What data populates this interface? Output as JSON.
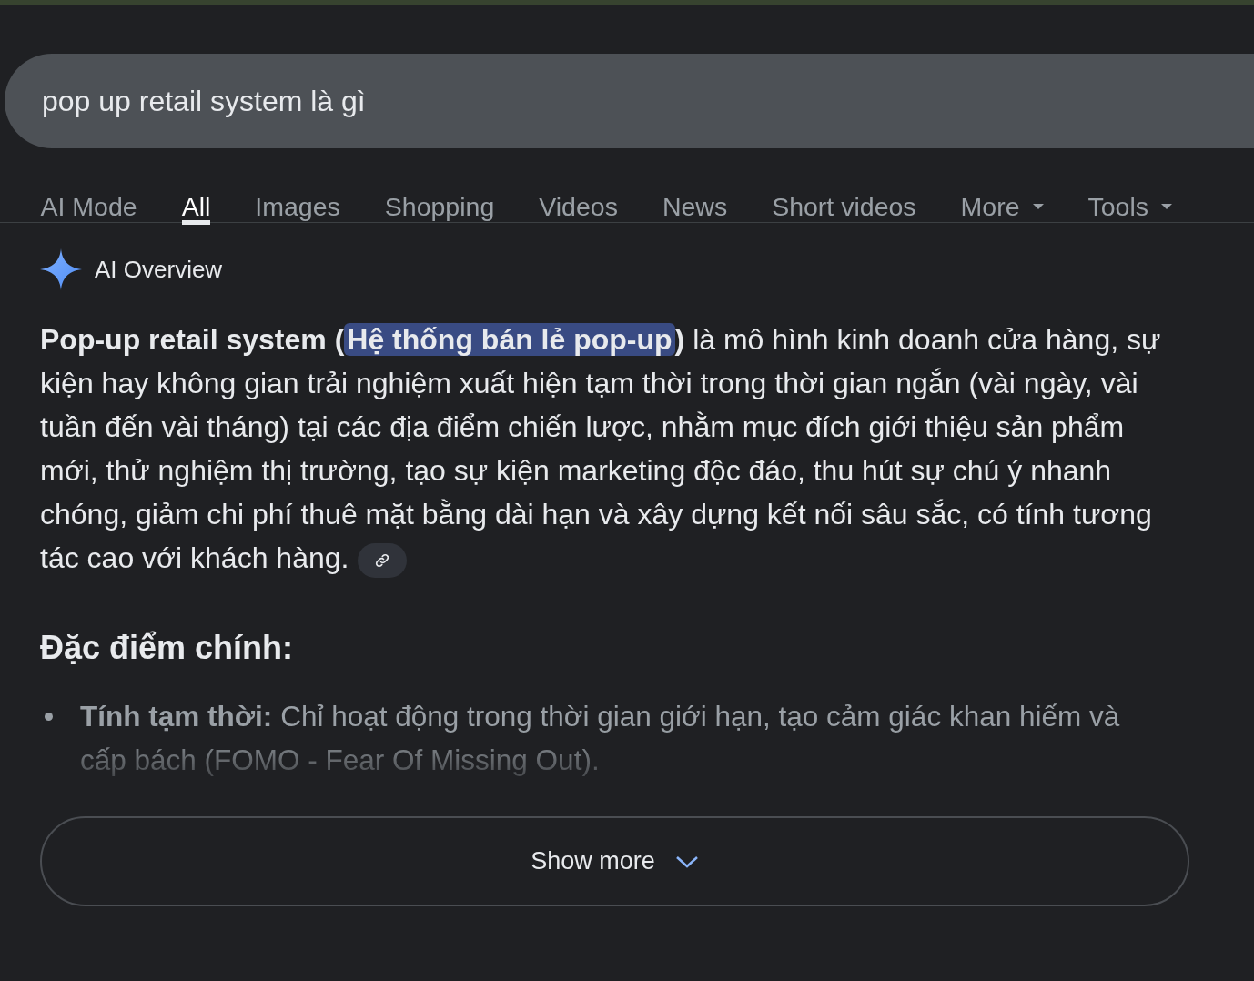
{
  "search": {
    "value": "pop up retail system là gì"
  },
  "tabs": [
    {
      "label": "AI Mode",
      "selected": false,
      "dropdown": false
    },
    {
      "label": "All",
      "selected": true,
      "dropdown": false
    },
    {
      "label": "Images",
      "selected": false,
      "dropdown": false
    },
    {
      "label": "Shopping",
      "selected": false,
      "dropdown": false
    },
    {
      "label": "Videos",
      "selected": false,
      "dropdown": false
    },
    {
      "label": "News",
      "selected": false,
      "dropdown": false
    },
    {
      "label": "Short videos",
      "selected": false,
      "dropdown": false
    },
    {
      "label": "More",
      "selected": false,
      "dropdown": true
    },
    {
      "label": "Tools",
      "selected": false,
      "dropdown": true
    }
  ],
  "overview": {
    "title": "AI Overview",
    "intro": {
      "lead": "Pop-up retail system (",
      "highlight": "Hệ thống bán lẻ pop-up",
      "close": ")",
      "body": " là mô hình kinh doanh cửa hàng, sự kiện hay không gian trải nghiệm xuất hiện tạm thời trong thời gian ngắn (vài ngày, vài tuần đến vài tháng) tại các địa điểm chiến lược, nhằm mục đích giới thiệu sản phẩm mới, thử nghiệm thị trường, tạo sự kiện marketing độc đáo, thu hút sự chú ý nhanh chóng, giảm chi phí thuê mặt bằng dài hạn và xây dựng kết nối sâu sắc, có tính tương tác cao với khách hàng."
    },
    "heading": "Đặc điểm chính:",
    "bullets": [
      "**Tính tạm thời:** Chỉ hoạt động trong thời gian giới hạn, tạo cảm giác khan hiếm và cấp bách (FOMO - Fear Of Missing Out)."
    ],
    "show_more": "Show more"
  }
}
